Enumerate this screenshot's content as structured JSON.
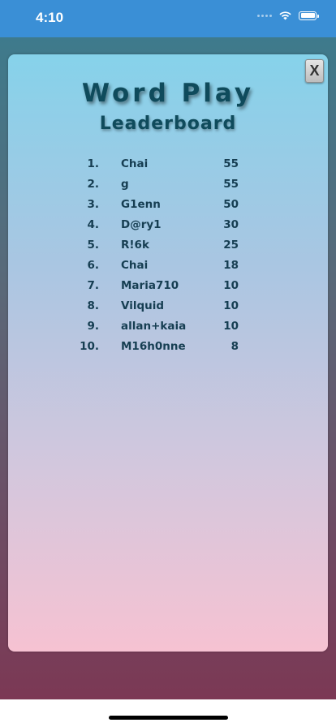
{
  "status_bar": {
    "time": "4:10"
  },
  "header": {
    "title": "Word Play",
    "subtitle": "Leaderboard"
  },
  "close": {
    "label": "X"
  },
  "leaderboard": [
    {
      "rank": "1.",
      "name": "Chai",
      "score": "55"
    },
    {
      "rank": "2.",
      "name": "g",
      "score": "55"
    },
    {
      "rank": "3.",
      "name": "G1enn",
      "score": "50"
    },
    {
      "rank": "4.",
      "name": "D@ry1",
      "score": "30"
    },
    {
      "rank": "5.",
      "name": "R!6k",
      "score": "25"
    },
    {
      "rank": "6.",
      "name": "Chai",
      "score": "18"
    },
    {
      "rank": "7.",
      "name": "Maria710",
      "score": "10"
    },
    {
      "rank": "8.",
      "name": "Vilquid",
      "score": "10"
    },
    {
      "rank": "9.",
      "name": "allan+kaia",
      "score": "10"
    },
    {
      "rank": "10.",
      "name": "M16h0nne",
      "score": "8"
    }
  ],
  "colors": {
    "status_bar": "#3a8fd6",
    "title_text": "#0f4b5c",
    "row_text": "#163e52"
  }
}
